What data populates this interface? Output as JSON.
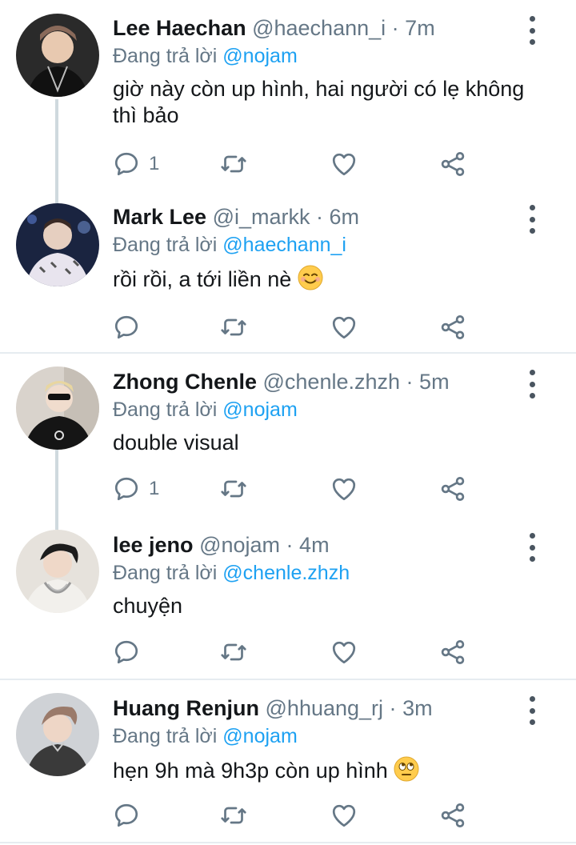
{
  "tweets": [
    {
      "name": "Lee Haechan",
      "handle": "@haechann_i",
      "dot": "·",
      "time": "7m",
      "replying_prefix": "Đang trả lời",
      "replying_to": "@nojam",
      "text_line1": "giờ này còn up hình, hai người có lẹ không",
      "text_line2": "thì bảo",
      "reply_count": "1",
      "avatar_colors": [
        "#2a2a2a",
        "#e8c9b0",
        "#8a6a5a"
      ]
    },
    {
      "name": "Mark Lee",
      "handle": "@i_markk",
      "dot": "·",
      "time": "6m",
      "replying_prefix": "Đang trả lời",
      "replying_to": "@haechann_i",
      "text": "rồi rồi, a tới liền nè",
      "emoji": "smiling-face-emoji",
      "reply_count": "",
      "avatar_colors": [
        "#1a2440",
        "#e6cfc0",
        "#b08a7a"
      ]
    },
    {
      "name": "Zhong Chenle",
      "handle": "@chenle.zhzh",
      "dot": "·",
      "time": "5m",
      "replying_prefix": "Đang trả lời",
      "replying_to": "@nojam",
      "text": "double visual",
      "reply_count": "1",
      "avatar_colors": [
        "#d9d3cc",
        "#f0dccd",
        "#1a1a1a"
      ]
    },
    {
      "name": "lee jeno",
      "handle": "@nojam",
      "dot": "·",
      "time": "4m",
      "replying_prefix": "Đang trả lời",
      "replying_to": "@chenle.zhzh",
      "text": "chuyện",
      "reply_count": "",
      "avatar_colors": [
        "#e6e2dc",
        "#efd8c8",
        "#1c1c1c"
      ]
    },
    {
      "name": "Huang Renjun",
      "handle": "@hhuang_rj",
      "dot": "·",
      "time": "3m",
      "replying_prefix": "Đang trả lời",
      "replying_to": "@nojam",
      "text": "hẹn 9h mà 9h3p còn up hình",
      "emoji": "eye-roll-emoji",
      "reply_count": "",
      "avatar_colors": [
        "#cfd2d6",
        "#eed6c6",
        "#9a7a6a"
      ]
    }
  ],
  "icons": {
    "reply": "reply-icon",
    "retweet": "retweet-icon",
    "like": "heart-icon",
    "share": "share-icon",
    "more": "more-vertical-icon"
  },
  "colors": {
    "link": "#1da1f2",
    "secondary": "#657786",
    "icon": "#657786",
    "divider": "#e6ecf0",
    "thread_line": "#cfd9de"
  }
}
